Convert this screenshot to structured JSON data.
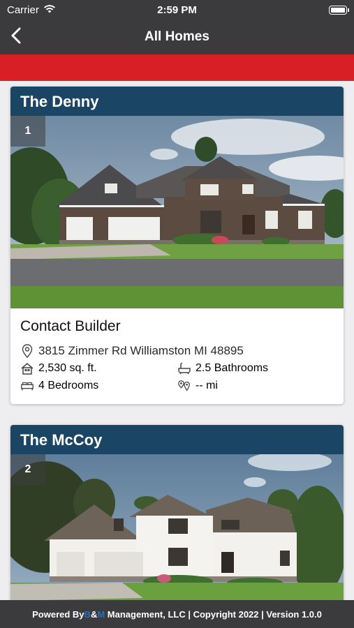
{
  "status_bar": {
    "carrier": "Carrier",
    "time": "2:59 PM"
  },
  "nav": {
    "title": "All Homes"
  },
  "homes": [
    {
      "name": "The Denny",
      "index": "1",
      "cta": "Contact Builder",
      "address": "3815 Zimmer Rd Williamston MI 48895",
      "sqft": "2,530 sq. ft.",
      "bathrooms": "2.5 Bathrooms",
      "bedrooms": "4 Bedrooms",
      "distance": "-- mi"
    },
    {
      "name": "The McCoy",
      "index": "2"
    }
  ],
  "footer": {
    "prefix": "Powered By ",
    "brand_b": "B",
    "brand_amp": "&",
    "brand_m": "M",
    "suffix": " Management, LLC | Copyright 2022 | Version 1.0.0"
  },
  "colors": {
    "header_bg": "#3b3b3d",
    "accent_red": "#d81f26",
    "card_title_bg": "#1b4564",
    "brand_blue": "#2d6fb3"
  },
  "icons": {
    "back": "chevron-left-icon",
    "wifi": "wifi-icon",
    "battery": "battery-icon",
    "address": "map-pin-icon",
    "sqft": "house-icon",
    "bathrooms": "bathtub-icon",
    "bedrooms": "bed-icon",
    "distance": "map-pins-icon"
  }
}
